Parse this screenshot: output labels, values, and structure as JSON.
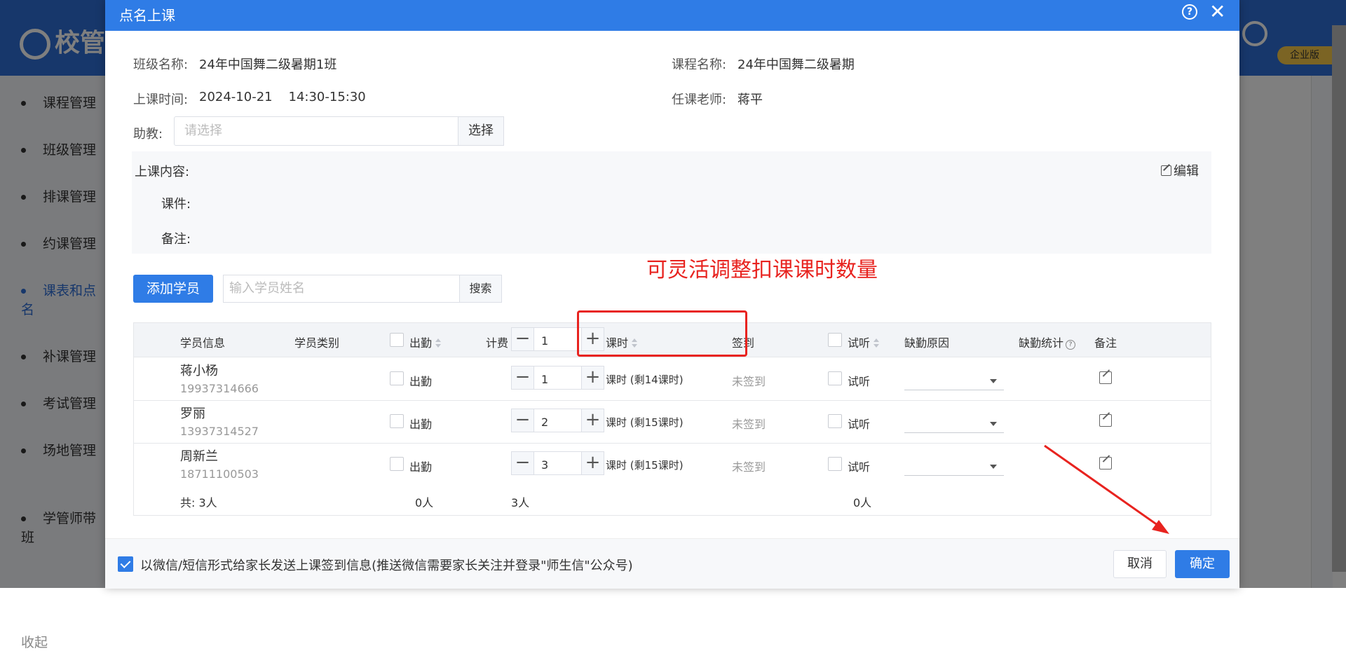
{
  "background": {
    "logo_text": "校管",
    "badge": "企业版",
    "sidebar": [
      "课程管理",
      "班级管理",
      "排课管理",
      "约课管理",
      "课表和点名",
      "补课管理",
      "考试管理",
      "场地管理",
      "学管师带班"
    ],
    "collapse": "收起"
  },
  "dialog": {
    "title": "点名上课",
    "help_icon": "?",
    "close_icon": "✕"
  },
  "info": {
    "class_label": "班级名称:",
    "class_value": "24年中国舞二级暑期1班",
    "course_label": "课程名称:",
    "course_value": "24年中国舞二级暑期",
    "time_label": "上课时间:",
    "time_value": "2024-10-21    14:30-15:30",
    "teacher_label": "任课老师:",
    "teacher_value": "蒋平",
    "assistant_label": "助教:",
    "assistant_placeholder": "请选择",
    "assistant_button": "选择"
  },
  "content": {
    "label": "上课内容:",
    "edit": "编辑",
    "courseware_label": "课件:",
    "remark_label": "备注:"
  },
  "annotation": "可灵活调整扣课课时数量",
  "toolbar": {
    "add_student": "添加学员",
    "search_placeholder": "输入学员姓名",
    "search_button": "搜索"
  },
  "table": {
    "headers": {
      "student_info": "学员信息",
      "student_type": "学员类别",
      "attend": "出勤",
      "charge": "计费",
      "charge_value": "1",
      "hours": "课时",
      "sign": "签到",
      "trial": "试听",
      "absence_reason": "缺勤原因",
      "absence_stats": "缺勤统计",
      "remark": "备注"
    },
    "rows": [
      {
        "name": "蒋小杨",
        "phone": "19937314666",
        "attend": "出勤",
        "count": "1",
        "hours": "课时 (剩14课时)",
        "sign": "未签到",
        "trial": "试听"
      },
      {
        "name": "罗丽",
        "phone": "13937314527",
        "attend": "出勤",
        "count": "2",
        "hours": "课时 (剩15课时)",
        "sign": "未签到",
        "trial": "试听"
      },
      {
        "name": "周新兰",
        "phone": "18711100503",
        "attend": "出勤",
        "count": "3",
        "hours": "课时 (剩15课时)",
        "sign": "未签到",
        "trial": "试听"
      }
    ],
    "summary": {
      "total": "共: 3人",
      "attend": "0人",
      "charge": "3人",
      "trial": "0人"
    }
  },
  "footer": {
    "notify_text": "以微信/短信形式给家长发送上课签到信息(推送微信需要家长关注并登录\"师生信\"公众号)",
    "notify_checked": true,
    "cancel": "取消",
    "confirm": "确定"
  },
  "colors": {
    "primary": "#2f7ce6",
    "annotation": "#e8231f"
  }
}
